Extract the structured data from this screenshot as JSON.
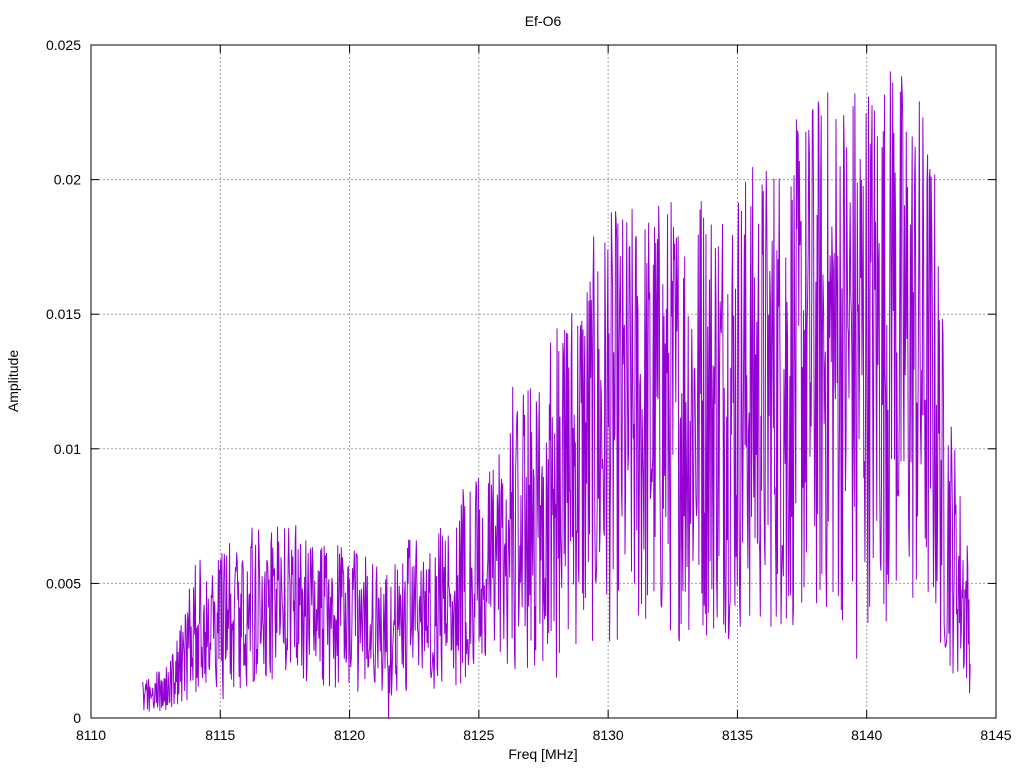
{
  "chart_data": {
    "type": "line",
    "title": "Ef-O6",
    "xlabel": "Freq [MHz]",
    "ylabel": "Amplitude",
    "xlim": [
      8110,
      8145
    ],
    "ylim": [
      0,
      0.025
    ],
    "x_ticks": [
      8110,
      8115,
      8120,
      8125,
      8130,
      8135,
      8140,
      8145
    ],
    "x_tick_labels": [
      "8110",
      "8115",
      "8120",
      "8125",
      "8130",
      "8135",
      "8140",
      "8145"
    ],
    "y_ticks": [
      0,
      0.005,
      0.01,
      0.015,
      0.02,
      0.025
    ],
    "y_tick_labels": [
      "0",
      "0.005",
      "0.01",
      "0.015",
      "0.02",
      "0.025"
    ],
    "grid": true,
    "legend": "none",
    "series": [
      {
        "color": "#9400d3",
        "x_start": 8112.0,
        "x_end": 8144.0,
        "envelope_points": [
          [
            8112.0,
            0.0008
          ],
          [
            8113.0,
            0.0012
          ],
          [
            8113.6,
            0.0022
          ],
          [
            8114.0,
            0.0033
          ],
          [
            8115.0,
            0.0036
          ],
          [
            8116.0,
            0.004
          ],
          [
            8117.0,
            0.0042
          ],
          [
            8118.0,
            0.0041
          ],
          [
            8119.0,
            0.0039
          ],
          [
            8120.0,
            0.0036
          ],
          [
            8121.0,
            0.0034
          ],
          [
            8121.5,
            0.003
          ],
          [
            8122.0,
            0.0038
          ],
          [
            8123.0,
            0.0038
          ],
          [
            8124.0,
            0.0046
          ],
          [
            8125.0,
            0.0052
          ],
          [
            8126.0,
            0.006
          ],
          [
            8127.0,
            0.0072
          ],
          [
            8128.0,
            0.0086
          ],
          [
            8129.0,
            0.0098
          ],
          [
            8130.0,
            0.0108
          ],
          [
            8131.0,
            0.011
          ],
          [
            8132.0,
            0.0112
          ],
          [
            8133.0,
            0.0113
          ],
          [
            8134.0,
            0.0115
          ],
          [
            8135.0,
            0.0118
          ],
          [
            8136.0,
            0.012
          ],
          [
            8137.0,
            0.0125
          ],
          [
            8138.0,
            0.0134
          ],
          [
            8139.0,
            0.0138
          ],
          [
            8140.0,
            0.014
          ],
          [
            8141.0,
            0.0142
          ],
          [
            8142.0,
            0.0136
          ],
          [
            8142.6,
            0.0122
          ],
          [
            8143.0,
            0.008
          ],
          [
            8143.5,
            0.0055
          ],
          [
            8144.0,
            0.0035
          ]
        ],
        "notable_values": [
          [
            8113.8,
            0.0048
          ],
          [
            8114.7,
            0.0053
          ],
          [
            8115.1,
            0.0007
          ],
          [
            8117.8,
            0.006
          ],
          [
            8121.5,
            0.0
          ],
          [
            8124.4,
            0.0085
          ],
          [
            8126.3,
            0.0123
          ],
          [
            8128.0,
            0.0015
          ],
          [
            8130.0,
            0.0174
          ],
          [
            8131.9,
            0.0178
          ],
          [
            8133.6,
            0.0192
          ],
          [
            8136.9,
            0.0037
          ],
          [
            8137.9,
            0.0225
          ],
          [
            8139.6,
            0.0022
          ],
          [
            8141.0,
            0.0236
          ],
          [
            8143.0,
            0.0035
          ],
          [
            8144.0,
            0.002
          ]
        ]
      }
    ]
  }
}
